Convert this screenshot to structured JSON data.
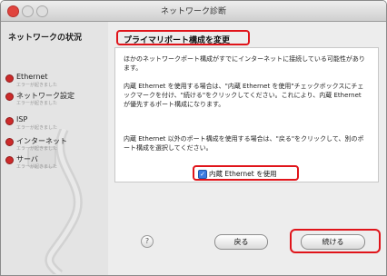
{
  "window": {
    "title": "ネットワーク診断"
  },
  "sidebar": {
    "title": "ネットワークの状況",
    "steps": [
      {
        "label": "Ethernet",
        "sub": "エラーが起きました"
      },
      {
        "label": "ネットワーク設定",
        "sub": "エラーが起きました"
      },
      {
        "label": "ISP",
        "sub": "エラーが起きました"
      },
      {
        "label": "インターネット",
        "sub": "エラーが起きました"
      },
      {
        "label": "サーバ",
        "sub": "エラーが起きました"
      }
    ]
  },
  "main": {
    "heading": "プライマリポート構成を変更",
    "para1": "ほかのネットワークポート構成がすでにインターネットに接続している可能性があります。",
    "para2": "内蔵 Ethernet を使用する場合は、\"内蔵 Ethernet を使用\"チェックボックスにチェックマークを付け、\"続ける\"をクリックしてください。これにより、内蔵 Ethernet が優先するポート構成になります。",
    "para3": "内蔵 Ethernet 以外のポート構成を使用する場合は、\"戻る\"をクリックして、別のポート構成を選択してください。",
    "checkbox_label": "内蔵 Ethernet を使用",
    "checkbox_checked": true
  },
  "footer": {
    "help_label": "?",
    "back_label": "戻る",
    "continue_label": "続ける"
  },
  "colors": {
    "highlight": "#e0141a",
    "status_dot": "#cc2a2a"
  },
  "icons": {
    "help": "help-icon",
    "check": "checkmark-icon",
    "cable": "ethernet-cable-icon"
  }
}
